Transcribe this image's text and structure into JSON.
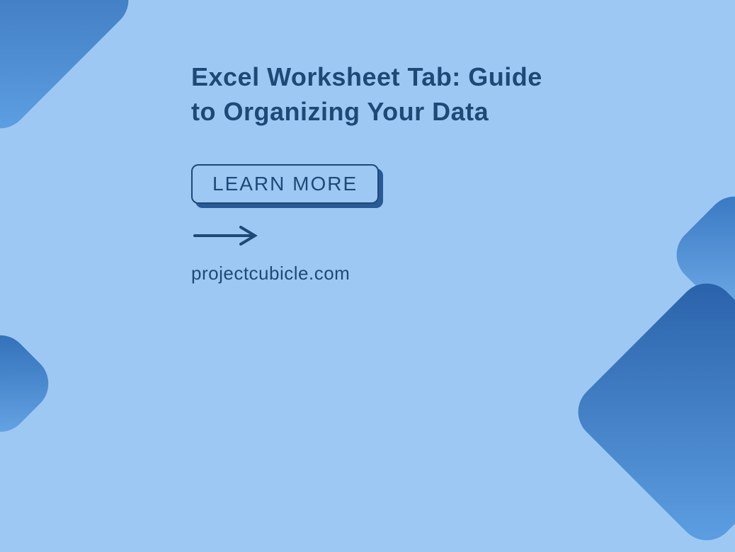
{
  "title": "Excel Worksheet Tab: Guide to Organizing Your Data",
  "button_label": "LEARN MORE",
  "website": "projectcubicle.com",
  "colors": {
    "background": "#9ec8f4",
    "text": "#1e4976",
    "accent": "#2d6bb5"
  }
}
